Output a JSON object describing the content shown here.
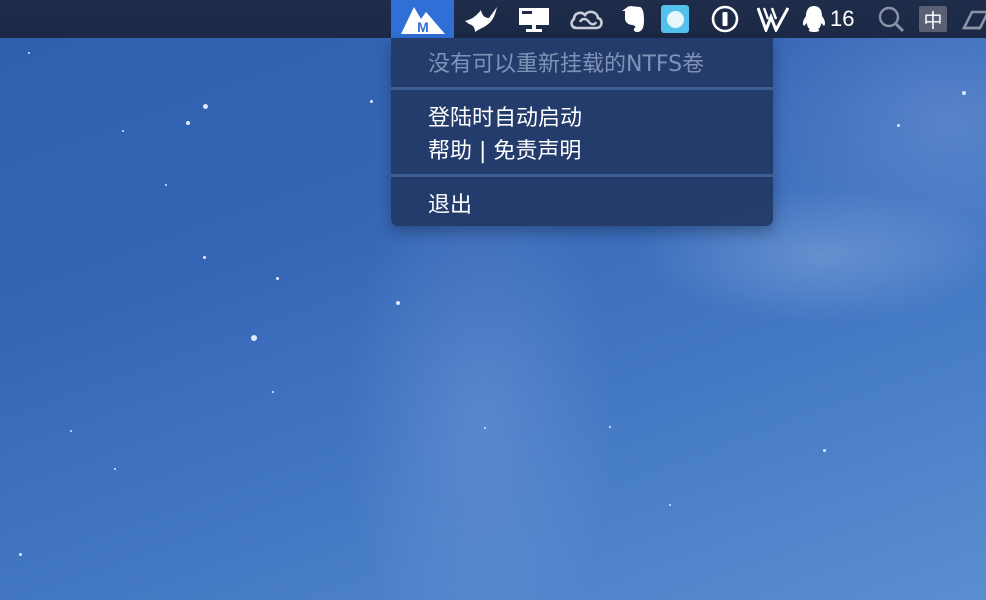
{
  "menubar": {
    "icons": [
      {
        "name": "ntfs-mounter-icon",
        "active": true
      },
      {
        "name": "bird-icon"
      },
      {
        "name": "monitor-icon"
      },
      {
        "name": "creative-cloud-icon"
      },
      {
        "name": "evernote-icon"
      },
      {
        "name": "ball-icon"
      },
      {
        "name": "onepassword-icon"
      },
      {
        "name": "double-v-icon"
      },
      {
        "name": "qq-icon"
      },
      {
        "name": "spotlight-icon"
      },
      {
        "name": "input-method-icon"
      },
      {
        "name": "eraser-icon"
      }
    ],
    "qq_count": "16",
    "input_method_label": "中",
    "accent_color": "#2f6fd6"
  },
  "dropdown": {
    "status_text": "没有可以重新挂载的NTFS卷",
    "items": [
      {
        "label": "登陆时自动启动"
      },
      {
        "label": "帮助 | 免责声明"
      },
      {
        "label": "退出"
      }
    ]
  }
}
